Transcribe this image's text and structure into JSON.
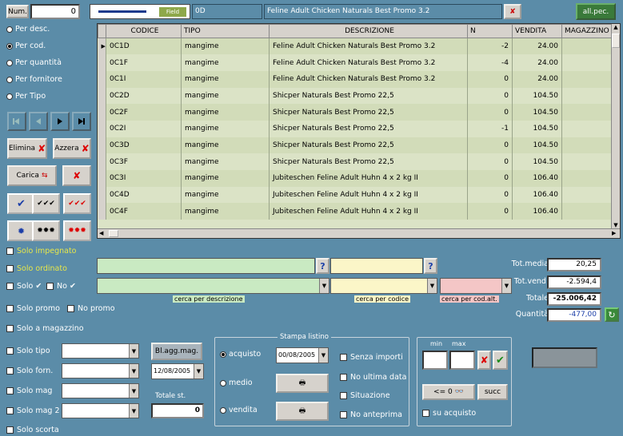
{
  "top": {
    "num_label": "Num.",
    "num_value": "0",
    "field_label": "Field",
    "field_value": "0D",
    "current_descr": "Feline Adult Chicken Naturals Best Promo 3.2",
    "right_button": "all.pec."
  },
  "sort": {
    "options": [
      "Per desc.",
      "Per cod.",
      "Per quantità",
      "Per fornitore",
      "Per Tipo"
    ],
    "selected": 1
  },
  "buttons": {
    "elimina": "Elimina",
    "azzera": "Azzera",
    "carica": "Carica"
  },
  "table": {
    "headers": [
      "CODICE",
      "TIPO",
      "DESCRIZIONE",
      "N",
      "VENDITA",
      "MAGAZZINO"
    ],
    "rows": [
      [
        "0C1D",
        "mangime",
        "Feline Adult Chicken Naturals Best Promo 3.2",
        "-2",
        "24.00",
        ""
      ],
      [
        "0C1F",
        "mangime",
        "Feline Adult Chicken Naturals Best Promo 3.2",
        "-4",
        "24.00",
        ""
      ],
      [
        "0C1I",
        "mangime",
        "Feline Adult Chicken Naturals Best Promo 3.2",
        "0",
        "24.00",
        ""
      ],
      [
        "0C2D",
        "mangime",
        "Shicper Naturals Best Promo 22,5",
        "0",
        "104.50",
        ""
      ],
      [
        "0C2F",
        "mangime",
        "Shicper Naturals Best Promo 22,5",
        "0",
        "104.50",
        ""
      ],
      [
        "0C2I",
        "mangime",
        "Shicper Naturals Best Promo 22,5",
        "-1",
        "104.50",
        ""
      ],
      [
        "0C3D",
        "mangime",
        "Shicper Naturals Best Promo 22,5",
        "0",
        "104.50",
        ""
      ],
      [
        "0C3F",
        "mangime",
        "Shicper Naturals Best Promo 22,5",
        "0",
        "104.50",
        ""
      ],
      [
        "0C3I",
        "mangime",
        "Jubiteschen Feline Adult Huhn 4 x 2 kg II",
        "0",
        "106.40",
        ""
      ],
      [
        "0C4D",
        "mangime",
        "Jubiteschen Feline Adult Huhn 4 x 2 kg II",
        "0",
        "106.40",
        ""
      ],
      [
        "0C4F",
        "mangime",
        "Jubiteschen Feline Adult Huhn 4 x 2 kg II",
        "0",
        "106.40",
        ""
      ]
    ]
  },
  "filters": {
    "impegnato": "Solo impegnato",
    "ordinato": "Solo ordinato",
    "solo_check": "Solo ✔",
    "no_check": "No ✔",
    "promo": "Solo promo",
    "no_promo": "No promo",
    "magazzino": "Solo a magazzino",
    "tipo": "Solo tipo",
    "forn": "Solo forn.",
    "mag": "Solo mag",
    "mag2": "Solo mag 2",
    "scorta": "Solo scorta"
  },
  "search": {
    "desc_hint": "cerca per descrizione",
    "cod_hint": "cerca per codice",
    "alt_hint": "cerca per cod.alt."
  },
  "totals": {
    "tot_media_label": "Tot.media",
    "tot_media": "20,25",
    "tot_vend_label": "Tot.vend.",
    "tot_vend": "-2.594,4",
    "totale_label": "Totale",
    "totale": "-25.006,42",
    "quantita_label": "Quantità",
    "quantita": "-477,00"
  },
  "bottom": {
    "aggiorna": "Bl.agg.mag.",
    "date": "12/08/2005",
    "tot_label": "Totale st.",
    "tot_value": "0",
    "stampa_title": "Stampa listino",
    "acquisto": "acquisto",
    "medio": "medio",
    "vendita": "vendita",
    "stampa_date": "00/08/2005",
    "senza_importi": "Senza importi",
    "no_ultima_data": "No ultima data",
    "situazione": "Situazione",
    "no_anteprima": "No anteprima",
    "min_label": "min",
    "max_label": "max",
    "prev_label": "<= 0",
    "succ_label": "succ",
    "su_acquisto": "su acquisto"
  }
}
